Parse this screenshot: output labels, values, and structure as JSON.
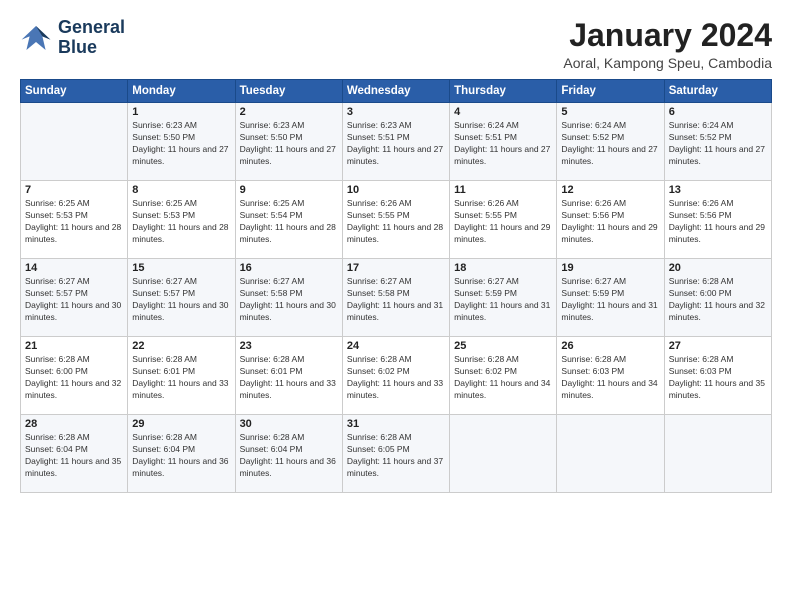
{
  "logo": {
    "line1": "General",
    "line2": "Blue"
  },
  "title": "January 2024",
  "location": "Aoral, Kampong Speu, Cambodia",
  "days_of_week": [
    "Sunday",
    "Monday",
    "Tuesday",
    "Wednesday",
    "Thursday",
    "Friday",
    "Saturday"
  ],
  "weeks": [
    [
      {
        "day": "",
        "sunrise": "",
        "sunset": "",
        "daylight": ""
      },
      {
        "day": "1",
        "sunrise": "Sunrise: 6:23 AM",
        "sunset": "Sunset: 5:50 PM",
        "daylight": "Daylight: 11 hours and 27 minutes."
      },
      {
        "day": "2",
        "sunrise": "Sunrise: 6:23 AM",
        "sunset": "Sunset: 5:50 PM",
        "daylight": "Daylight: 11 hours and 27 minutes."
      },
      {
        "day": "3",
        "sunrise": "Sunrise: 6:23 AM",
        "sunset": "Sunset: 5:51 PM",
        "daylight": "Daylight: 11 hours and 27 minutes."
      },
      {
        "day": "4",
        "sunrise": "Sunrise: 6:24 AM",
        "sunset": "Sunset: 5:51 PM",
        "daylight": "Daylight: 11 hours and 27 minutes."
      },
      {
        "day": "5",
        "sunrise": "Sunrise: 6:24 AM",
        "sunset": "Sunset: 5:52 PM",
        "daylight": "Daylight: 11 hours and 27 minutes."
      },
      {
        "day": "6",
        "sunrise": "Sunrise: 6:24 AM",
        "sunset": "Sunset: 5:52 PM",
        "daylight": "Daylight: 11 hours and 27 minutes."
      }
    ],
    [
      {
        "day": "7",
        "sunrise": "Sunrise: 6:25 AM",
        "sunset": "Sunset: 5:53 PM",
        "daylight": "Daylight: 11 hours and 28 minutes."
      },
      {
        "day": "8",
        "sunrise": "Sunrise: 6:25 AM",
        "sunset": "Sunset: 5:53 PM",
        "daylight": "Daylight: 11 hours and 28 minutes."
      },
      {
        "day": "9",
        "sunrise": "Sunrise: 6:25 AM",
        "sunset": "Sunset: 5:54 PM",
        "daylight": "Daylight: 11 hours and 28 minutes."
      },
      {
        "day": "10",
        "sunrise": "Sunrise: 6:26 AM",
        "sunset": "Sunset: 5:55 PM",
        "daylight": "Daylight: 11 hours and 28 minutes."
      },
      {
        "day": "11",
        "sunrise": "Sunrise: 6:26 AM",
        "sunset": "Sunset: 5:55 PM",
        "daylight": "Daylight: 11 hours and 29 minutes."
      },
      {
        "day": "12",
        "sunrise": "Sunrise: 6:26 AM",
        "sunset": "Sunset: 5:56 PM",
        "daylight": "Daylight: 11 hours and 29 minutes."
      },
      {
        "day": "13",
        "sunrise": "Sunrise: 6:26 AM",
        "sunset": "Sunset: 5:56 PM",
        "daylight": "Daylight: 11 hours and 29 minutes."
      }
    ],
    [
      {
        "day": "14",
        "sunrise": "Sunrise: 6:27 AM",
        "sunset": "Sunset: 5:57 PM",
        "daylight": "Daylight: 11 hours and 30 minutes."
      },
      {
        "day": "15",
        "sunrise": "Sunrise: 6:27 AM",
        "sunset": "Sunset: 5:57 PM",
        "daylight": "Daylight: 11 hours and 30 minutes."
      },
      {
        "day": "16",
        "sunrise": "Sunrise: 6:27 AM",
        "sunset": "Sunset: 5:58 PM",
        "daylight": "Daylight: 11 hours and 30 minutes."
      },
      {
        "day": "17",
        "sunrise": "Sunrise: 6:27 AM",
        "sunset": "Sunset: 5:58 PM",
        "daylight": "Daylight: 11 hours and 31 minutes."
      },
      {
        "day": "18",
        "sunrise": "Sunrise: 6:27 AM",
        "sunset": "Sunset: 5:59 PM",
        "daylight": "Daylight: 11 hours and 31 minutes."
      },
      {
        "day": "19",
        "sunrise": "Sunrise: 6:27 AM",
        "sunset": "Sunset: 5:59 PM",
        "daylight": "Daylight: 11 hours and 31 minutes."
      },
      {
        "day": "20",
        "sunrise": "Sunrise: 6:28 AM",
        "sunset": "Sunset: 6:00 PM",
        "daylight": "Daylight: 11 hours and 32 minutes."
      }
    ],
    [
      {
        "day": "21",
        "sunrise": "Sunrise: 6:28 AM",
        "sunset": "Sunset: 6:00 PM",
        "daylight": "Daylight: 11 hours and 32 minutes."
      },
      {
        "day": "22",
        "sunrise": "Sunrise: 6:28 AM",
        "sunset": "Sunset: 6:01 PM",
        "daylight": "Daylight: 11 hours and 33 minutes."
      },
      {
        "day": "23",
        "sunrise": "Sunrise: 6:28 AM",
        "sunset": "Sunset: 6:01 PM",
        "daylight": "Daylight: 11 hours and 33 minutes."
      },
      {
        "day": "24",
        "sunrise": "Sunrise: 6:28 AM",
        "sunset": "Sunset: 6:02 PM",
        "daylight": "Daylight: 11 hours and 33 minutes."
      },
      {
        "day": "25",
        "sunrise": "Sunrise: 6:28 AM",
        "sunset": "Sunset: 6:02 PM",
        "daylight": "Daylight: 11 hours and 34 minutes."
      },
      {
        "day": "26",
        "sunrise": "Sunrise: 6:28 AM",
        "sunset": "Sunset: 6:03 PM",
        "daylight": "Daylight: 11 hours and 34 minutes."
      },
      {
        "day": "27",
        "sunrise": "Sunrise: 6:28 AM",
        "sunset": "Sunset: 6:03 PM",
        "daylight": "Daylight: 11 hours and 35 minutes."
      }
    ],
    [
      {
        "day": "28",
        "sunrise": "Sunrise: 6:28 AM",
        "sunset": "Sunset: 6:04 PM",
        "daylight": "Daylight: 11 hours and 35 minutes."
      },
      {
        "day": "29",
        "sunrise": "Sunrise: 6:28 AM",
        "sunset": "Sunset: 6:04 PM",
        "daylight": "Daylight: 11 hours and 36 minutes."
      },
      {
        "day": "30",
        "sunrise": "Sunrise: 6:28 AM",
        "sunset": "Sunset: 6:04 PM",
        "daylight": "Daylight: 11 hours and 36 minutes."
      },
      {
        "day": "31",
        "sunrise": "Sunrise: 6:28 AM",
        "sunset": "Sunset: 6:05 PM",
        "daylight": "Daylight: 11 hours and 37 minutes."
      },
      {
        "day": "",
        "sunrise": "",
        "sunset": "",
        "daylight": ""
      },
      {
        "day": "",
        "sunrise": "",
        "sunset": "",
        "daylight": ""
      },
      {
        "day": "",
        "sunrise": "",
        "sunset": "",
        "daylight": ""
      }
    ]
  ]
}
